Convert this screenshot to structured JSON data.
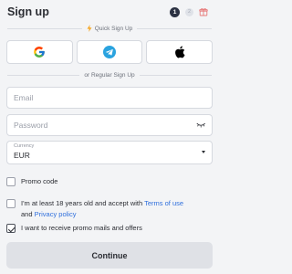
{
  "header": {
    "title": "Sign up",
    "steps": [
      "1",
      "2"
    ]
  },
  "quick_signup": {
    "label": "Quick Sign Up",
    "providers": [
      {
        "name": "google-icon"
      },
      {
        "name": "telegram-icon"
      },
      {
        "name": "apple-icon"
      }
    ]
  },
  "regular_signup": {
    "label": "or Regular Sign Up"
  },
  "form": {
    "email_placeholder": "Email",
    "password_placeholder": "Password",
    "currency_caption": "Currency",
    "currency_value": "EUR"
  },
  "checks": {
    "promo_code": "Promo code",
    "age_text": "I'm at least 18 years old and accept with",
    "terms_link": "Terms of use",
    "and_text": "and",
    "privacy_link": "Privacy policy",
    "promo_mails": "I want to receive promo mails and offers",
    "promo_mails_checked": true
  },
  "continue_label": "Continue",
  "colors": {
    "background": "#f3f4f6",
    "link": "#2f6fdc",
    "button": "#dfe1e6"
  }
}
